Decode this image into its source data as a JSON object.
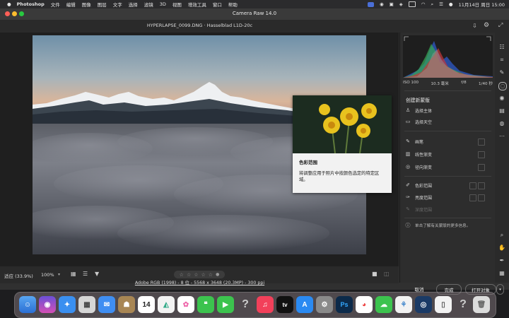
{
  "menubar": {
    "app_name": "Photoshop",
    "items": [
      "文件",
      "编辑",
      "图像",
      "图层",
      "文字",
      "选择",
      "滤镜",
      "3D",
      "视图",
      "增效工具",
      "窗口",
      "帮助"
    ],
    "clock": "11月14日 周日 15:00"
  },
  "window": {
    "title": "Camera Raw 14.0",
    "file_label": "HYPERLAPSE_0099.DNG · Hasselblad L1D-20c"
  },
  "histogram": {
    "exif": [
      "ISO 100",
      "10.3 毫米",
      "f/8",
      "1/40 秒"
    ]
  },
  "masking_panel": {
    "heading": "创建新蒙版",
    "items": [
      {
        "label": "选择主体",
        "icon": "person-icon"
      },
      {
        "label": "选择天空",
        "icon": "sky-icon"
      },
      {
        "label": "画笔",
        "icon": "brush-icon"
      },
      {
        "label": "线性渐变",
        "icon": "linear-gradient-icon"
      },
      {
        "label": "径向渐变",
        "icon": "radial-gradient-icon"
      },
      {
        "label": "色彩范围",
        "icon": "color-range-icon"
      },
      {
        "label": "亮度范围",
        "icon": "luminance-range-icon"
      },
      {
        "label": "深度范围",
        "icon": "depth-range-icon"
      }
    ],
    "help_text": "单击了解有关蒙版的更多信息。"
  },
  "tooltip": {
    "title": "色彩范围",
    "description": "将调整应用于照片中按颜色选定的特定区域。"
  },
  "bottombar": {
    "zoom_fit": "适应 (33.9%)",
    "zoom_level": "100%",
    "stars": [
      "☆",
      "☆",
      "☆",
      "☆",
      "☆"
    ]
  },
  "footer": {
    "workflow_link": "Adobe RGB (1998) - 8 位 - 5568 x 3648 (20.3MP) - 300 ppi",
    "cancel": "取消",
    "done": "完成",
    "open": "打开对象"
  },
  "dock": {
    "calendar_day": "14",
    "photoshop": "Ps",
    "appletv": "tv"
  }
}
